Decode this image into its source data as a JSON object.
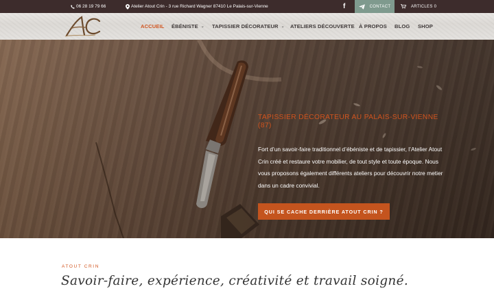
{
  "topbar": {
    "phone": "06 28 19 79 66",
    "address": "Atelier Atout Crin - 3 rue Richard Wagner 87410 Le Palais-sur-Vienne",
    "facebook_icon": "f",
    "contact_label": "CONTACT",
    "cart_label": "ARTICLES 0"
  },
  "logo": {
    "letters": "AC"
  },
  "nav": {
    "items": [
      {
        "label": "ACCUEIL",
        "active": true
      },
      {
        "label": "ÉBÉNISTE",
        "dropdown": true
      },
      {
        "label": "TAPISSIER DÉCORATEUR",
        "dropdown": true
      },
      {
        "label": "ATELIERS DÉCOUVERTE"
      },
      {
        "label": "À PROPOS"
      },
      {
        "label": "BLOG"
      },
      {
        "label": "SHOP"
      }
    ],
    "caret": "⌄"
  },
  "hero": {
    "title": "TAPISSIER DÉCORATEUR AU PALAIS-SUR-VIENNE (87)",
    "text": "Fort d’un savoir-faire traditionnel d’ébéniste et de tapissier, l’Atelier Atout Crin créé et restaure votre mobilier, de tout style et toute époque. Nous vous proposons également différents ateliers pour découvrir notre metier dans un cadre convivial.",
    "button_label": "QUI SE CACHE DERRIÈRE ATOUT CRIN ?"
  },
  "section": {
    "kicker": "ATOUT CRIN",
    "title": "Savoir-faire, expérience, créativité et travail soigné."
  },
  "colors": {
    "topbar": "#3d2c2c",
    "accent": "#d2541e",
    "button": "#c4541e",
    "contact": "#7f9a8e"
  },
  "icons": {
    "phone": "phone-icon",
    "address": "map-pin-icon",
    "facebook": "facebook-icon",
    "contact": "paper-plane-icon",
    "cart": "cart-icon"
  }
}
